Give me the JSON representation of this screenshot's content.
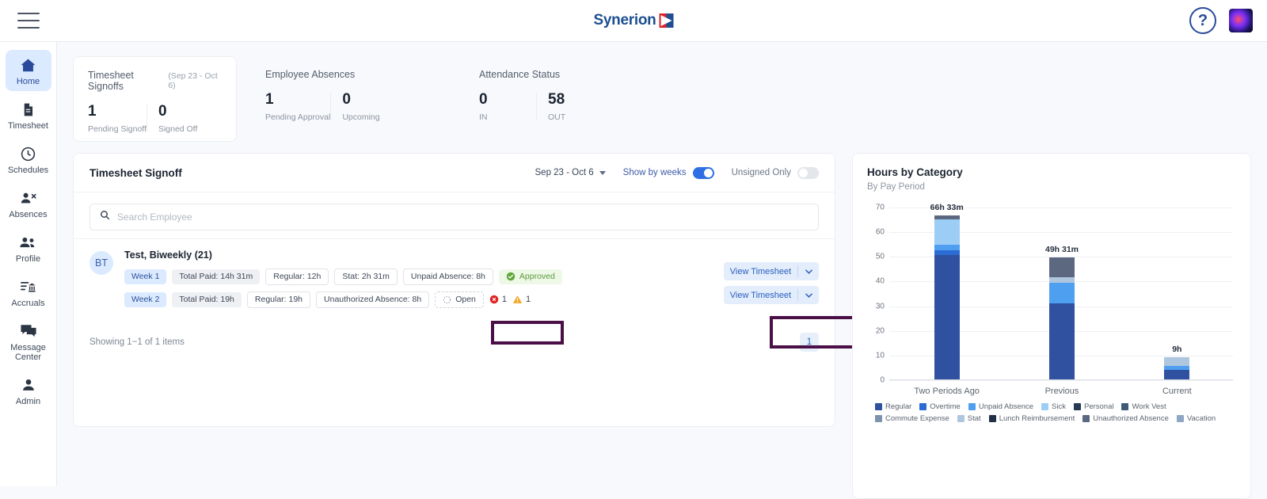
{
  "topbar": {
    "menu_icon": "hamburger-icon",
    "brand": "Synerion",
    "help_label": "?",
    "avatar_label": ""
  },
  "sidebar": {
    "items": [
      {
        "label": "Home",
        "icon": "home-icon",
        "active": true
      },
      {
        "label": "Timesheet",
        "icon": "document-icon",
        "active": false
      },
      {
        "label": "Schedules",
        "icon": "clock-icon",
        "active": false
      },
      {
        "label": "Absences",
        "icon": "person-remove-icon",
        "active": false
      },
      {
        "label": "Profile",
        "icon": "people-icon",
        "active": false
      },
      {
        "label": "Accruals",
        "icon": "list-bank-icon",
        "active": false
      },
      {
        "label": "Message Center",
        "icon": "chat-icon",
        "active": false
      },
      {
        "label": "Admin",
        "icon": "person-icon",
        "active": false
      }
    ]
  },
  "summary": {
    "cards": [
      {
        "title": "Timesheet Signoffs",
        "subtitle": "(Sep 23 - Oct 6)",
        "stats": [
          {
            "value": "1",
            "label": "Pending Signoff"
          },
          {
            "value": "0",
            "label": "Signed Off"
          }
        ]
      },
      {
        "title": "Employee Absences",
        "subtitle": "",
        "stats": [
          {
            "value": "1",
            "label": "Pending Approval"
          },
          {
            "value": "0",
            "label": "Upcoming"
          }
        ]
      },
      {
        "title": "Attendance Status",
        "subtitle": "",
        "stats": [
          {
            "value": "0",
            "label": "IN"
          },
          {
            "value": "58",
            "label": "OUT"
          }
        ]
      }
    ]
  },
  "signoff": {
    "title": "Timesheet Signoff",
    "date_range": "Sep 23 - Oct 6",
    "toggles": [
      {
        "label": "Show by weeks",
        "state": "on"
      },
      {
        "label": "Unsigned Only",
        "state": "off"
      }
    ],
    "search": {
      "placeholder": "Search Employee",
      "value": ""
    },
    "employee": {
      "initials": "BT",
      "name": "Test, Biweekly (21)",
      "weeks": [
        {
          "week": "Week 1",
          "total_paid": "Total Paid: 14h 31m",
          "chips": [
            "Regular: 12h",
            "Stat: 2h 31m",
            "Unpaid Absence: 8h"
          ],
          "status": "Approved",
          "status_type": "approved",
          "action": "View Timesheet",
          "errors": "",
          "warnings": ""
        },
        {
          "week": "Week 2",
          "total_paid": "Total Paid: 19h",
          "chips": [
            "Regular: 19h",
            "Unauthorized Absence: 8h"
          ],
          "status": "Open",
          "status_type": "open",
          "action": "View Timesheet",
          "errors": "1",
          "warnings": "1"
        }
      ]
    },
    "showing": "Showing 1−1 of 1 items",
    "page": "1",
    "highlight_color": "#4b0f47"
  },
  "chart_data": {
    "type": "bar",
    "stacked": true,
    "title": "Hours by Category",
    "subtitle": "By Pay Period",
    "xlabel": "",
    "ylabel": "",
    "ylim": [
      0,
      70
    ],
    "yticks": [
      0,
      10,
      20,
      30,
      40,
      50,
      60,
      70
    ],
    "grid": true,
    "legend_position": "bottom",
    "categories": [
      "Two Periods Ago",
      "Previous",
      "Current"
    ],
    "bar_labels": [
      "66h 33m",
      "49h 31m",
      "9h"
    ],
    "totals": [
      66.55,
      49.52,
      9
    ],
    "series": [
      {
        "name": "Regular",
        "color": "#2f51a0",
        "values": [
          50.5,
          30.9,
          4.0
        ]
      },
      {
        "name": "Overtime",
        "color": "#2b6cd4",
        "values": [
          1.8,
          0.0,
          0.0
        ]
      },
      {
        "name": "Unpaid Absence",
        "color": "#4f9ff0",
        "values": [
          2.2,
          8.2,
          1.6
        ]
      },
      {
        "name": "Sick",
        "color": "#9ccdf5",
        "values": [
          10.4,
          0.0,
          0.0
        ]
      },
      {
        "name": "Personal",
        "color": "#243b53",
        "values": [
          0.0,
          0.0,
          0.0
        ]
      },
      {
        "name": "Work Vest",
        "color": "#3f5a77",
        "values": [
          0.0,
          0.0,
          0.0
        ]
      },
      {
        "name": "Commute Expense",
        "color": "#7d93ad",
        "values": [
          0.0,
          0.0,
          0.0
        ]
      },
      {
        "name": "Stat",
        "color": "#aec6de",
        "values": [
          0.0,
          2.4,
          3.4
        ]
      },
      {
        "name": "Lunch Reimbursement",
        "color": "#1f3047",
        "values": [
          0.0,
          0.0,
          0.0
        ]
      },
      {
        "name": "Unauthorized Absence",
        "color": "#5c6880",
        "values": [
          1.65,
          8.02,
          0.0
        ]
      },
      {
        "name": "Vacation",
        "color": "#8fa6c4",
        "values": [
          0.0,
          0.0,
          0.0
        ]
      }
    ]
  }
}
